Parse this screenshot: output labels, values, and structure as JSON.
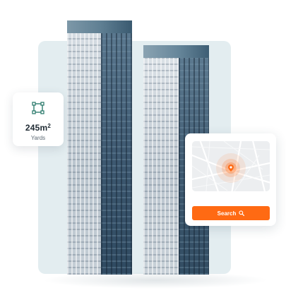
{
  "area_card": {
    "icon": "area-measure-icon",
    "value": "245m",
    "superscript": "2",
    "unit": "Yards"
  },
  "map_card": {
    "map_icon": "location-pin-icon",
    "search_label": "Search",
    "search_icon": "search-icon"
  },
  "colors": {
    "accent": "#ff6a13",
    "icon_teal": "#2f7d6e",
    "backdrop": "#e3edf0"
  }
}
